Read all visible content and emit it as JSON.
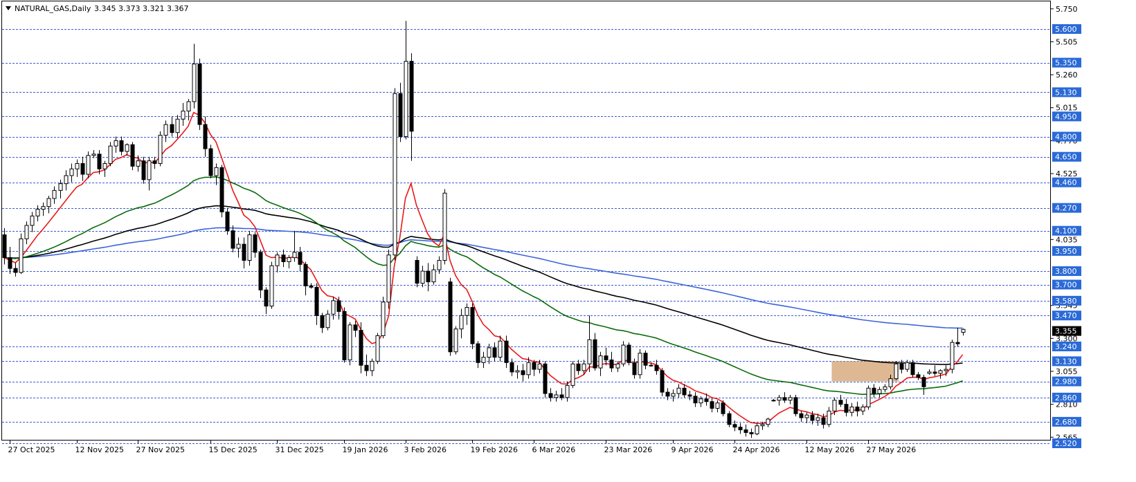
{
  "header": {
    "symbol": "NATURAL_GAS,Daily",
    "ohlc": "3.345 3.373 3.321 3.367"
  },
  "colors": {
    "background": "#ffffff",
    "level_line": "#3c5ad2",
    "bull_candle_fill": "#ffffff",
    "bear_candle_fill": "#000000",
    "candle_outline": "#000000",
    "ma_red": "#e81818",
    "ma_green": "#0a6a0a",
    "ma_black": "#000000",
    "ma_blue": "#3c64d8",
    "zone_fill": "#d2a06e",
    "price_tag_fill": "#2a6ad8",
    "price_tag_text": "#ffffff",
    "current_price_tag": "#000000"
  },
  "chart_data": {
    "type": "candlestick",
    "title": "NATURAL_GAS,Daily",
    "ylim": [
      2.49,
      5.79
    ],
    "grid": false,
    "y_ticks": [
      "5.750",
      "5.505",
      "5.260",
      "5.015",
      "4.770",
      "4.525",
      "4.035",
      "3.545",
      "3.300",
      "3.055",
      "2.810",
      "2.565"
    ],
    "level_lines": [
      "5.600",
      "5.350",
      "5.130",
      "4.950",
      "4.800",
      "4.650",
      "4.460",
      "4.270",
      "4.100",
      "3.950",
      "3.800",
      "3.700",
      "3.580",
      "3.470",
      "3.240",
      "3.130",
      "2.980",
      "2.860",
      "2.680",
      "2.520"
    ],
    "current_price": "3.355",
    "x_tick_labels": [
      "27 Oct 2025",
      "12 Nov 2025",
      "27 Nov 2025",
      "15 Dec 2025",
      "31 Dec 2025",
      "19 Jan 2026",
      "3 Feb 2026",
      "19 Feb 2026",
      "6 Mar 2026",
      "23 Mar 2026",
      "9 Apr 2026",
      "24 Apr 2026",
      "12 May 2026",
      "27 May 2026"
    ],
    "x_tick_positions": [
      1,
      13,
      24,
      37,
      49,
      61,
      72,
      84,
      95,
      108,
      120,
      131,
      144,
      155
    ],
    "zone": {
      "from_index": 149,
      "to_index": 160,
      "top": 3.13,
      "bottom": 2.98
    },
    "candles": [
      {
        "o": 4.07,
        "h": 4.12,
        "l": 3.85,
        "c": 3.9
      },
      {
        "o": 3.9,
        "h": 3.98,
        "l": 3.78,
        "c": 3.82
      },
      {
        "o": 3.82,
        "h": 3.86,
        "l": 3.76,
        "c": 3.79
      },
      {
        "o": 3.79,
        "h": 4.08,
        "l": 3.78,
        "c": 4.04
      },
      {
        "o": 4.04,
        "h": 4.17,
        "l": 4.0,
        "c": 4.14
      },
      {
        "o": 4.14,
        "h": 4.24,
        "l": 4.09,
        "c": 4.21
      },
      {
        "o": 4.21,
        "h": 4.29,
        "l": 4.17,
        "c": 4.26
      },
      {
        "o": 4.26,
        "h": 4.31,
        "l": 4.21,
        "c": 4.28
      },
      {
        "o": 4.28,
        "h": 4.36,
        "l": 4.23,
        "c": 4.34
      },
      {
        "o": 4.34,
        "h": 4.43,
        "l": 4.3,
        "c": 4.4
      },
      {
        "o": 4.4,
        "h": 4.48,
        "l": 4.34,
        "c": 4.45
      },
      {
        "o": 4.45,
        "h": 4.55,
        "l": 4.4,
        "c": 4.51
      },
      {
        "o": 4.51,
        "h": 4.6,
        "l": 4.46,
        "c": 4.56
      },
      {
        "o": 4.56,
        "h": 4.63,
        "l": 4.5,
        "c": 4.6
      },
      {
        "o": 4.6,
        "h": 4.65,
        "l": 4.47,
        "c": 4.52
      },
      {
        "o": 4.52,
        "h": 4.69,
        "l": 4.49,
        "c": 4.66
      },
      {
        "o": 4.66,
        "h": 4.7,
        "l": 4.64,
        "c": 4.67
      },
      {
        "o": 4.67,
        "h": 4.7,
        "l": 4.52,
        "c": 4.56
      },
      {
        "o": 4.56,
        "h": 4.62,
        "l": 4.5,
        "c": 4.6
      },
      {
        "o": 4.6,
        "h": 4.76,
        "l": 4.58,
        "c": 4.73
      },
      {
        "o": 4.73,
        "h": 4.8,
        "l": 4.68,
        "c": 4.77
      },
      {
        "o": 4.77,
        "h": 4.8,
        "l": 4.66,
        "c": 4.69
      },
      {
        "o": 4.69,
        "h": 4.75,
        "l": 4.66,
        "c": 4.74
      },
      {
        "o": 4.74,
        "h": 4.76,
        "l": 4.55,
        "c": 4.58
      },
      {
        "o": 4.58,
        "h": 4.66,
        "l": 4.54,
        "c": 4.62
      },
      {
        "o": 4.62,
        "h": 4.65,
        "l": 4.45,
        "c": 4.48
      },
      {
        "o": 4.48,
        "h": 4.65,
        "l": 4.4,
        "c": 4.62
      },
      {
        "o": 4.62,
        "h": 4.65,
        "l": 4.56,
        "c": 4.6
      },
      {
        "o": 4.6,
        "h": 4.84,
        "l": 4.58,
        "c": 4.81
      },
      {
        "o": 4.81,
        "h": 4.92,
        "l": 4.76,
        "c": 4.89
      },
      {
        "o": 4.89,
        "h": 4.95,
        "l": 4.8,
        "c": 4.83
      },
      {
        "o": 4.83,
        "h": 4.96,
        "l": 4.79,
        "c": 4.93
      },
      {
        "o": 4.93,
        "h": 5.05,
        "l": 4.88,
        "c": 4.99
      },
      {
        "o": 4.99,
        "h": 5.08,
        "l": 4.92,
        "c": 5.06
      },
      {
        "o": 5.06,
        "h": 5.49,
        "l": 5.01,
        "c": 5.34
      },
      {
        "o": 5.34,
        "h": 5.38,
        "l": 4.85,
        "c": 4.89
      },
      {
        "o": 4.89,
        "h": 4.95,
        "l": 4.65,
        "c": 4.71
      },
      {
        "o": 4.71,
        "h": 4.74,
        "l": 4.49,
        "c": 4.51
      },
      {
        "o": 4.51,
        "h": 4.6,
        "l": 4.44,
        "c": 4.57
      },
      {
        "o": 4.57,
        "h": 4.59,
        "l": 4.2,
        "c": 4.24
      },
      {
        "o": 4.24,
        "h": 4.27,
        "l": 4.07,
        "c": 4.1
      },
      {
        "o": 4.1,
        "h": 4.14,
        "l": 3.94,
        "c": 3.97
      },
      {
        "o": 3.97,
        "h": 4.05,
        "l": 3.9,
        "c": 4.0
      },
      {
        "o": 4.0,
        "h": 4.05,
        "l": 3.82,
        "c": 3.88
      },
      {
        "o": 3.88,
        "h": 4.1,
        "l": 3.84,
        "c": 4.07
      },
      {
        "o": 4.07,
        "h": 4.09,
        "l": 3.9,
        "c": 3.94
      },
      {
        "o": 3.94,
        "h": 3.96,
        "l": 3.6,
        "c": 3.66
      },
      {
        "o": 3.66,
        "h": 3.68,
        "l": 3.48,
        "c": 3.54
      },
      {
        "o": 3.54,
        "h": 3.87,
        "l": 3.52,
        "c": 3.84
      },
      {
        "o": 3.84,
        "h": 3.94,
        "l": 3.79,
        "c": 3.92
      },
      {
        "o": 3.92,
        "h": 3.96,
        "l": 3.83,
        "c": 3.87
      },
      {
        "o": 3.87,
        "h": 3.92,
        "l": 3.82,
        "c": 3.9
      },
      {
        "o": 3.9,
        "h": 4.1,
        "l": 3.87,
        "c": 3.94
      },
      {
        "o": 3.94,
        "h": 3.98,
        "l": 3.8,
        "c": 3.85
      },
      {
        "o": 3.85,
        "h": 3.87,
        "l": 3.62,
        "c": 3.69
      },
      {
        "o": 3.69,
        "h": 3.71,
        "l": 3.67,
        "c": 3.68
      },
      {
        "o": 3.68,
        "h": 3.71,
        "l": 3.4,
        "c": 3.47
      },
      {
        "o": 3.47,
        "h": 3.49,
        "l": 3.34,
        "c": 3.38
      },
      {
        "o": 3.38,
        "h": 3.51,
        "l": 3.36,
        "c": 3.48
      },
      {
        "o": 3.48,
        "h": 3.61,
        "l": 3.44,
        "c": 3.58
      },
      {
        "o": 3.58,
        "h": 3.61,
        "l": 3.44,
        "c": 3.5
      },
      {
        "o": 3.5,
        "h": 3.53,
        "l": 3.12,
        "c": 3.14
      },
      {
        "o": 3.14,
        "h": 3.42,
        "l": 3.1,
        "c": 3.4
      },
      {
        "o": 3.4,
        "h": 3.43,
        "l": 3.31,
        "c": 3.36
      },
      {
        "o": 3.36,
        "h": 3.42,
        "l": 3.04,
        "c": 3.1
      },
      {
        "o": 3.1,
        "h": 3.18,
        "l": 3.02,
        "c": 3.06
      },
      {
        "o": 3.06,
        "h": 3.15,
        "l": 3.02,
        "c": 3.13
      },
      {
        "o": 3.13,
        "h": 3.34,
        "l": 3.11,
        "c": 3.32
      },
      {
        "o": 3.32,
        "h": 3.61,
        "l": 3.3,
        "c": 3.57
      },
      {
        "o": 3.57,
        "h": 3.96,
        "l": 3.52,
        "c": 3.92
      },
      {
        "o": 3.92,
        "h": 5.16,
        "l": 3.88,
        "c": 5.12
      },
      {
        "o": 5.12,
        "h": 5.2,
        "l": 4.76,
        "c": 4.8
      },
      {
        "o": 4.8,
        "h": 5.66,
        "l": 4.78,
        "c": 5.36
      },
      {
        "o": 5.36,
        "h": 5.42,
        "l": 4.62,
        "c": 4.84
      },
      {
        "o": 3.88,
        "h": 3.91,
        "l": 3.68,
        "c": 3.71
      },
      {
        "o": 3.71,
        "h": 3.84,
        "l": 3.68,
        "c": 3.8
      },
      {
        "o": 3.8,
        "h": 3.86,
        "l": 3.65,
        "c": 3.72
      },
      {
        "o": 3.72,
        "h": 3.85,
        "l": 3.7,
        "c": 3.81
      },
      {
        "o": 3.81,
        "h": 3.91,
        "l": 3.78,
        "c": 3.88
      },
      {
        "o": 3.88,
        "h": 4.41,
        "l": 3.85,
        "c": 4.38
      },
      {
        "o": 3.72,
        "h": 3.75,
        "l": 3.17,
        "c": 3.2
      },
      {
        "o": 3.2,
        "h": 3.39,
        "l": 3.18,
        "c": 3.37
      },
      {
        "o": 3.37,
        "h": 3.52,
        "l": 3.3,
        "c": 3.47
      },
      {
        "o": 3.47,
        "h": 3.56,
        "l": 3.4,
        "c": 3.53
      },
      {
        "o": 3.53,
        "h": 3.56,
        "l": 3.22,
        "c": 3.26
      },
      {
        "o": 3.26,
        "h": 3.28,
        "l": 3.08,
        "c": 3.12
      },
      {
        "o": 3.12,
        "h": 3.2,
        "l": 3.08,
        "c": 3.16
      },
      {
        "o": 3.16,
        "h": 3.26,
        "l": 3.11,
        "c": 3.23
      },
      {
        "o": 3.23,
        "h": 3.27,
        "l": 3.13,
        "c": 3.16
      },
      {
        "o": 3.16,
        "h": 3.32,
        "l": 3.13,
        "c": 3.28
      },
      {
        "o": 3.28,
        "h": 3.32,
        "l": 3.08,
        "c": 3.12
      },
      {
        "o": 3.12,
        "h": 3.15,
        "l": 3.02,
        "c": 3.05
      },
      {
        "o": 3.05,
        "h": 3.1,
        "l": 3.0,
        "c": 3.06
      },
      {
        "o": 3.06,
        "h": 3.11,
        "l": 2.98,
        "c": 3.03
      },
      {
        "o": 3.03,
        "h": 3.16,
        "l": 3.0,
        "c": 3.12
      },
      {
        "o": 3.12,
        "h": 3.14,
        "l": 3.02,
        "c": 3.07
      },
      {
        "o": 3.07,
        "h": 3.14,
        "l": 3.04,
        "c": 3.11
      },
      {
        "o": 3.11,
        "h": 3.13,
        "l": 2.86,
        "c": 2.89
      },
      {
        "o": 2.89,
        "h": 2.93,
        "l": 2.83,
        "c": 2.86
      },
      {
        "o": 2.86,
        "h": 2.91,
        "l": 2.83,
        "c": 2.88
      },
      {
        "o": 2.88,
        "h": 2.93,
        "l": 2.84,
        "c": 2.86
      },
      {
        "o": 2.86,
        "h": 2.98,
        "l": 2.83,
        "c": 2.95
      },
      {
        "o": 2.95,
        "h": 3.13,
        "l": 2.93,
        "c": 3.11
      },
      {
        "o": 3.11,
        "h": 3.14,
        "l": 3.03,
        "c": 3.06
      },
      {
        "o": 3.06,
        "h": 3.14,
        "l": 3.03,
        "c": 3.11
      },
      {
        "o": 3.11,
        "h": 3.47,
        "l": 3.05,
        "c": 3.29
      },
      {
        "o": 3.29,
        "h": 3.34,
        "l": 3.06,
        "c": 3.08
      },
      {
        "o": 3.08,
        "h": 3.2,
        "l": 3.02,
        "c": 3.17
      },
      {
        "o": 3.17,
        "h": 3.23,
        "l": 3.1,
        "c": 3.14
      },
      {
        "o": 3.14,
        "h": 3.2,
        "l": 3.05,
        "c": 3.08
      },
      {
        "o": 3.08,
        "h": 3.13,
        "l": 3.05,
        "c": 3.11
      },
      {
        "o": 3.11,
        "h": 3.28,
        "l": 3.09,
        "c": 3.25
      },
      {
        "o": 3.25,
        "h": 3.27,
        "l": 3.1,
        "c": 3.12
      },
      {
        "o": 3.12,
        "h": 3.15,
        "l": 3.0,
        "c": 3.03
      },
      {
        "o": 3.03,
        "h": 3.22,
        "l": 3.0,
        "c": 3.19
      },
      {
        "o": 3.19,
        "h": 3.21,
        "l": 3.07,
        "c": 3.1
      },
      {
        "o": 3.1,
        "h": 3.12,
        "l": 3.09,
        "c": 3.1
      },
      {
        "o": 3.1,
        "h": 3.14,
        "l": 3.03,
        "c": 3.06
      },
      {
        "o": 3.06,
        "h": 3.08,
        "l": 2.87,
        "c": 2.9
      },
      {
        "o": 2.9,
        "h": 2.93,
        "l": 2.84,
        "c": 2.87
      },
      {
        "o": 2.87,
        "h": 2.92,
        "l": 2.83,
        "c": 2.89
      },
      {
        "o": 2.89,
        "h": 2.96,
        "l": 2.86,
        "c": 2.93
      },
      {
        "o": 2.93,
        "h": 2.96,
        "l": 2.86,
        "c": 2.88
      },
      {
        "o": 2.88,
        "h": 2.91,
        "l": 2.84,
        "c": 2.87
      },
      {
        "o": 2.87,
        "h": 2.9,
        "l": 2.79,
        "c": 2.82
      },
      {
        "o": 2.82,
        "h": 2.87,
        "l": 2.79,
        "c": 2.85
      },
      {
        "o": 2.85,
        "h": 2.89,
        "l": 2.8,
        "c": 2.83
      },
      {
        "o": 2.83,
        "h": 2.86,
        "l": 2.75,
        "c": 2.78
      },
      {
        "o": 2.78,
        "h": 2.84,
        "l": 2.75,
        "c": 2.82
      },
      {
        "o": 2.82,
        "h": 2.84,
        "l": 2.72,
        "c": 2.74
      },
      {
        "o": 2.74,
        "h": 2.76,
        "l": 2.64,
        "c": 2.66
      },
      {
        "o": 2.66,
        "h": 2.69,
        "l": 2.61,
        "c": 2.64
      },
      {
        "o": 2.64,
        "h": 2.67,
        "l": 2.59,
        "c": 2.62
      },
      {
        "o": 2.62,
        "h": 2.66,
        "l": 2.57,
        "c": 2.6
      },
      {
        "o": 2.6,
        "h": 2.63,
        "l": 2.56,
        "c": 2.59
      },
      {
        "o": 2.59,
        "h": 2.67,
        "l": 2.58,
        "c": 2.65
      },
      {
        "o": 2.65,
        "h": 2.68,
        "l": 2.62,
        "c": 2.66
      },
      {
        "o": 2.66,
        "h": 2.71,
        "l": 2.64,
        "c": 2.7
      },
      {
        "o": 2.84,
        "h": 2.85,
        "l": 2.83,
        "c": 2.84
      },
      {
        "o": 2.84,
        "h": 2.88,
        "l": 2.8,
        "c": 2.86
      },
      {
        "o": 2.86,
        "h": 2.9,
        "l": 2.82,
        "c": 2.84
      },
      {
        "o": 2.84,
        "h": 2.88,
        "l": 2.81,
        "c": 2.86
      },
      {
        "o": 2.86,
        "h": 2.88,
        "l": 2.72,
        "c": 2.74
      },
      {
        "o": 2.74,
        "h": 2.76,
        "l": 2.68,
        "c": 2.71
      },
      {
        "o": 2.71,
        "h": 2.75,
        "l": 2.67,
        "c": 2.73
      },
      {
        "o": 2.73,
        "h": 2.76,
        "l": 2.66,
        "c": 2.69
      },
      {
        "o": 2.69,
        "h": 2.74,
        "l": 2.65,
        "c": 2.71
      },
      {
        "o": 2.71,
        "h": 2.74,
        "l": 2.63,
        "c": 2.66
      },
      {
        "o": 2.66,
        "h": 2.79,
        "l": 2.64,
        "c": 2.76
      },
      {
        "o": 2.76,
        "h": 2.86,
        "l": 2.73,
        "c": 2.84
      },
      {
        "o": 2.84,
        "h": 2.88,
        "l": 2.79,
        "c": 2.81
      },
      {
        "o": 2.81,
        "h": 2.85,
        "l": 2.72,
        "c": 2.75
      },
      {
        "o": 2.75,
        "h": 2.82,
        "l": 2.72,
        "c": 2.79
      },
      {
        "o": 2.79,
        "h": 2.83,
        "l": 2.72,
        "c": 2.76
      },
      {
        "o": 2.76,
        "h": 2.81,
        "l": 2.73,
        "c": 2.79
      },
      {
        "o": 2.79,
        "h": 2.95,
        "l": 2.77,
        "c": 2.93
      },
      {
        "o": 2.93,
        "h": 2.96,
        "l": 2.86,
        "c": 2.89
      },
      {
        "o": 2.89,
        "h": 2.94,
        "l": 2.86,
        "c": 2.92
      },
      {
        "o": 2.92,
        "h": 2.96,
        "l": 2.9,
        "c": 2.94
      },
      {
        "o": 2.94,
        "h": 3.03,
        "l": 2.92,
        "c": 3.0
      },
      {
        "o": 3.0,
        "h": 3.13,
        "l": 2.99,
        "c": 3.11
      },
      {
        "o": 3.11,
        "h": 3.14,
        "l": 3.04,
        "c": 3.07
      },
      {
        "o": 3.07,
        "h": 3.14,
        "l": 3.05,
        "c": 3.12
      },
      {
        "o": 3.12,
        "h": 3.14,
        "l": 3.01,
        "c": 3.03
      },
      {
        "o": 3.03,
        "h": 3.05,
        "l": 2.99,
        "c": 3.01
      },
      {
        "o": 3.01,
        "h": 3.03,
        "l": 2.88,
        "c": 2.94
      },
      {
        "o": 3.04,
        "h": 3.07,
        "l": 3.03,
        "c": 3.05
      },
      {
        "o": 3.05,
        "h": 3.1,
        "l": 3.02,
        "c": 3.04
      },
      {
        "o": 3.04,
        "h": 3.07,
        "l": 3.0,
        "c": 3.06
      },
      {
        "o": 3.06,
        "h": 3.1,
        "l": 3.02,
        "c": 3.07
      },
      {
        "o": 3.07,
        "h": 3.29,
        "l": 3.04,
        "c": 3.27
      },
      {
        "o": 3.27,
        "h": 3.38,
        "l": 3.24,
        "c": 3.26
      },
      {
        "o": 3.345,
        "h": 3.373,
        "l": 3.321,
        "c": 3.367
      }
    ]
  }
}
